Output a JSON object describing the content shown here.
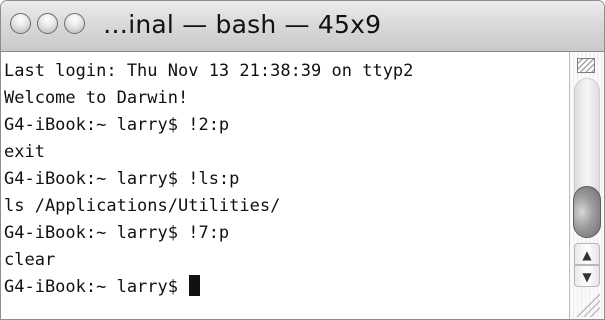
{
  "window": {
    "title": "…inal — bash — 45x9"
  },
  "terminal": {
    "lines": [
      "Last login: Thu Nov 13 21:38:39 on ttyp2",
      "Welcome to Darwin!",
      "G4-iBook:~ larry$ !2:p",
      "exit",
      "G4-iBook:~ larry$ !ls:p",
      "ls /Applications/Utilities/",
      "G4-iBook:~ larry$ !7:p",
      "clear",
      "G4-iBook:~ larry$ "
    ]
  },
  "scrollbar": {
    "up_arrow": "▲",
    "down_arrow": "▼"
  },
  "icons": {
    "close": "close-icon",
    "minimize": "minimize-icon",
    "zoom": "zoom-icon",
    "cursor": "text-cursor-icon",
    "resize": "resize-grip-icon"
  }
}
